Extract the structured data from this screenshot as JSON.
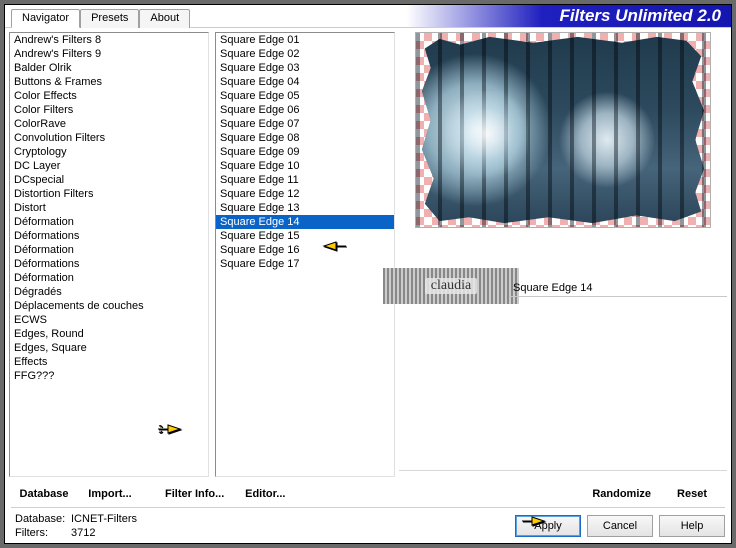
{
  "app_title": "Filters Unlimited 2.0",
  "tabs": {
    "navigator": "Navigator",
    "presets": "Presets",
    "about": "About"
  },
  "categories": [
    "Andrew's Filters 8",
    "Andrew's Filters 9",
    "Balder Olrik",
    "Buttons & Frames",
    "Color Effects",
    "Color Filters",
    "ColorRave",
    "Convolution Filters",
    "Cryptology",
    "DC Layer",
    "DCspecial",
    "Distortion Filters",
    "Distort",
    "Déformation",
    "Déformations",
    "Déformation",
    "Déformations",
    "Déformation",
    "Dégradés",
    "Déplacements de couches",
    "ECWS",
    "Edges, Round",
    "Edges, Square",
    "Effects",
    "FFG???"
  ],
  "highlighted_category_index": 22,
  "filters": [
    "Square Edge 01",
    "Square Edge 02",
    "Square Edge 03",
    "Square Edge 04",
    "Square Edge 05",
    "Square Edge 06",
    "Square Edge 07",
    "Square Edge 08",
    "Square Edge 09",
    "Square Edge 10",
    "Square Edge 11",
    "Square Edge 12",
    "Square Edge 13",
    "Square Edge 14",
    "Square Edge 15",
    "Square Edge 16",
    "Square Edge 17"
  ],
  "selected_filter_index": 13,
  "current_filter_name": "Square Edge 14",
  "watermark_text": "claudia",
  "toolbar": {
    "database": "Database",
    "import": "Import...",
    "filter_info": "Filter Info...",
    "editor": "Editor...",
    "randomize": "Randomize",
    "reset": "Reset"
  },
  "status": {
    "db_label": "Database:",
    "db_value": "ICNET-Filters",
    "filters_label": "Filters:",
    "filters_value": "3712"
  },
  "buttons": {
    "apply": "Apply",
    "cancel": "Cancel",
    "help": "Help"
  }
}
